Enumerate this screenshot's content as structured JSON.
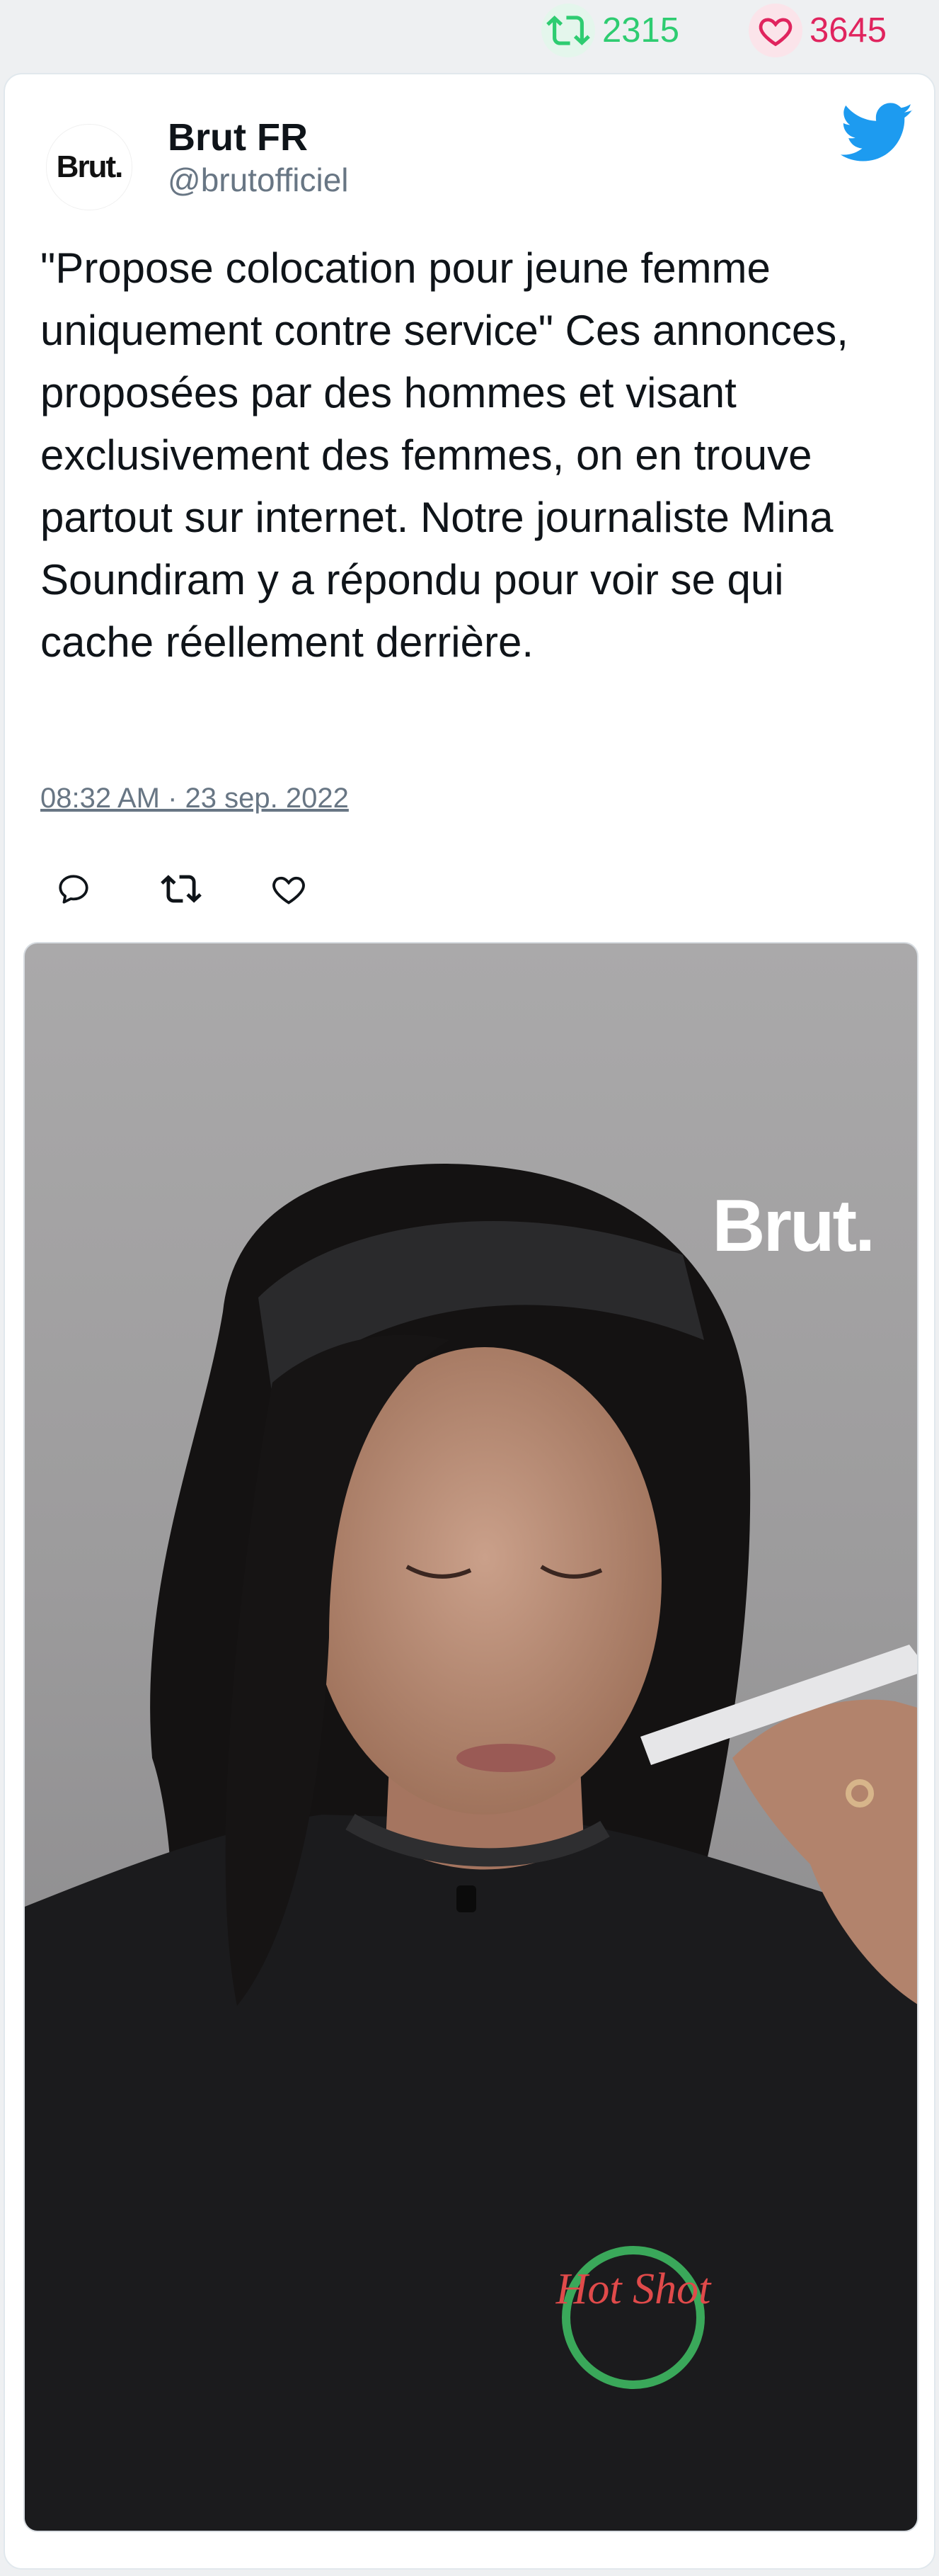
{
  "stats": {
    "retweets": "2315",
    "likes": "3645"
  },
  "tweet": {
    "avatar_text": "Brut.",
    "author_name": "Brut FR",
    "author_handle": "@brutofficiel",
    "text": "\"Propose colocation pour jeune femme uniquement contre service\" Ces annonces, proposées par des hommes et visant exclusivement des femmes, on en trouve partout sur internet. Notre journaliste Mina Soundiram y a répondu pour voir se qui cache réellement derrière.",
    "timestamp": "08:32 AM · 23 sep. 2022"
  },
  "media": {
    "brand_watermark": "Brut.",
    "shirt_logo": "Hot Shot"
  },
  "colors": {
    "retweet": "#2ecc71",
    "like": "#e0245e",
    "twitter_blue": "#1d9bf0",
    "muted": "#687684"
  },
  "icons": {
    "retweet_stat": "retweet-icon",
    "like_stat": "heart-icon",
    "brand": "twitter-bird-icon",
    "reply": "reply-icon",
    "retweet": "retweet-icon",
    "like": "heart-icon"
  }
}
